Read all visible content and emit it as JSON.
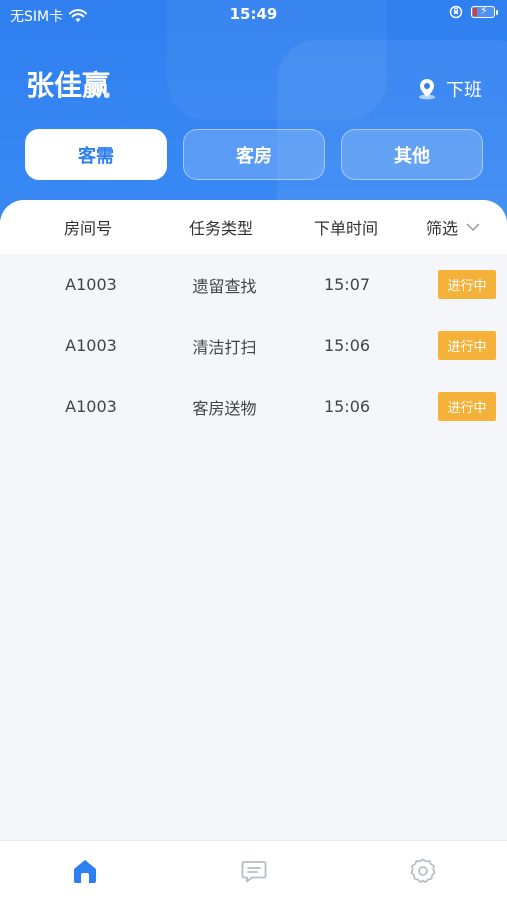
{
  "status_bar": {
    "carrier": "无SIM卡",
    "time": "15:49"
  },
  "user": {
    "name": "张佳赢"
  },
  "header": {
    "offduty_label": "下班",
    "offduty_icon": "location-pin-icon"
  },
  "tabs": [
    {
      "label": "客需",
      "active": true
    },
    {
      "label": "客房",
      "active": false
    },
    {
      "label": "其他",
      "active": false
    }
  ],
  "table": {
    "columns": [
      "房间号",
      "任务类型",
      "下单时间",
      "筛选"
    ],
    "rows": [
      {
        "room": "A1003",
        "type": "遗留查找",
        "time": "15:07",
        "status": "进行中"
      },
      {
        "room": "A1003",
        "type": "清洁打扫",
        "time": "15:06",
        "status": "进行中"
      },
      {
        "room": "A1003",
        "type": "客房送物",
        "time": "15:06",
        "status": "进行中"
      }
    ]
  },
  "bottom_nav": [
    {
      "icon": "home-icon",
      "active": true
    },
    {
      "icon": "message-icon",
      "active": false
    },
    {
      "icon": "settings-icon",
      "active": false
    }
  ],
  "colors": {
    "primary": "#2f7ff0",
    "badge": "#f5b23b",
    "icon_inactive": "#b7bcc7"
  }
}
